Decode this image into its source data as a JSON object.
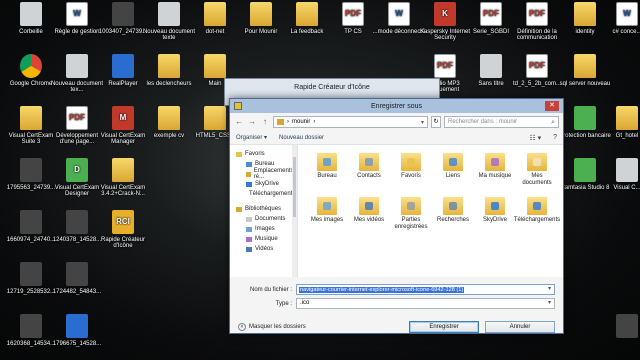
{
  "desktop": {
    "icons": [
      {
        "label": "Corbeille",
        "kind": "gray",
        "glyph": ""
      },
      {
        "label": "Règle de gestion",
        "kind": "word",
        "glyph": "W"
      },
      {
        "label": "1003407_24739...",
        "kind": "dark",
        "glyph": ""
      },
      {
        "label": "Nouveau document texte",
        "kind": "gray",
        "glyph": ""
      },
      {
        "label": "dot-net",
        "kind": "folder",
        "glyph": ""
      },
      {
        "label": "Pour Mounir",
        "kind": "folder",
        "glyph": ""
      },
      {
        "label": "La feedback",
        "kind": "folder",
        "glyph": ""
      },
      {
        "label": "TP CS",
        "kind": "pdf",
        "glyph": "PDF"
      },
      {
        "label": "...mode déconnecté",
        "kind": "word",
        "glyph": "W"
      },
      {
        "label": "Kaspersky Internet Security",
        "kind": "red",
        "glyph": "K"
      },
      {
        "label": "Serie_SGBDI",
        "kind": "pdf",
        "glyph": "PDF"
      },
      {
        "label": "Définition de la communication",
        "kind": "pdf",
        "glyph": "PDF"
      },
      {
        "label": "identity",
        "kind": "folder",
        "glyph": ""
      },
      {
        "label": "c# conce...",
        "kind": "word",
        "glyph": "W"
      },
      {
        "label": "Google Chrome",
        "kind": "chrome",
        "glyph": ""
      },
      {
        "label": "Nouveau document tex...",
        "kind": "gray",
        "glyph": ""
      },
      {
        "label": "RealPlayer",
        "kind": "blue",
        "glyph": ""
      },
      {
        "label": "les declencheurs",
        "kind": "folder",
        "glyph": ""
      },
      {
        "label": "Main",
        "kind": "folder",
        "glyph": ""
      },
      {
        "label": "Audio MP3 ...quement",
        "kind": "pdf",
        "glyph": "PDF"
      },
      {
        "label": "Sans titre",
        "kind": "gray",
        "glyph": ""
      },
      {
        "label": "td_2_5_2b_com...",
        "kind": "pdf",
        "glyph": "PDF"
      },
      {
        "label": "sql server nouveau",
        "kind": "folder",
        "glyph": ""
      },
      {
        "label": "Visual CertExam Suite 3",
        "kind": "folder",
        "glyph": ""
      },
      {
        "label": "Développement d'une page...",
        "kind": "pdf",
        "glyph": "PDF"
      },
      {
        "label": "Visual CertExam Manager",
        "kind": "red",
        "glyph": "M"
      },
      {
        "label": "exemple cv",
        "kind": "folder",
        "glyph": ""
      },
      {
        "label": "HTML5_CSS3",
        "kind": "folder",
        "glyph": ""
      },
      {
        "label": "Protection bancaire",
        "kind": "green",
        "glyph": ""
      },
      {
        "label": "Gt_hotel",
        "kind": "folder",
        "glyph": ""
      },
      {
        "label": "1795563_24739...",
        "kind": "dark",
        "glyph": ""
      },
      {
        "label": "Visual CertExam Designer",
        "kind": "green",
        "glyph": "D"
      },
      {
        "label": "Visual CertExam 3.4.2+Crack-N...",
        "kind": "folder",
        "glyph": ""
      },
      {
        "label": "Camtasia Studio 8",
        "kind": "green",
        "glyph": ""
      },
      {
        "label": "Visual C...",
        "kind": "gray",
        "glyph": ""
      },
      {
        "label": "1660974_24740...",
        "kind": "dark",
        "glyph": ""
      },
      {
        "label": "1240378_14528...",
        "kind": "dark",
        "glyph": ""
      },
      {
        "label": "Rapide Créateur d'Icône",
        "kind": "yellow",
        "glyph": "RCI"
      },
      {
        "label": "12719_2528532...",
        "kind": "dark",
        "glyph": ""
      },
      {
        "label": "1724482_54843...",
        "kind": "dark",
        "glyph": ""
      },
      {
        "label": "1620368_14534...",
        "kind": "dark",
        "glyph": ""
      },
      {
        "label": "1796675_14528...",
        "kind": "blue",
        "glyph": ""
      },
      {
        "label": "",
        "kind": "dark",
        "glyph": ""
      }
    ]
  },
  "bg_window": {
    "title": "Rapide Créateur d'Icône"
  },
  "dialog": {
    "title": "Enregistrer sous",
    "close_glyph": "✕",
    "back_glyph": "←",
    "forward_glyph": "→",
    "up_glyph": "↑",
    "path_sep": "›",
    "path_current": "mounir",
    "path_dd": "▾",
    "refresh_glyph": "↻",
    "search_placeholder": "Rechercher dans : mounir",
    "search_glyph": "⌕",
    "toolbar": {
      "organize": "Organiser ▾",
      "new_folder": "Nouveau dossier",
      "view_glyph": "☷ ▾",
      "help_glyph": "?"
    },
    "nav": {
      "favorites": "Favoris",
      "fav_items": [
        "Bureau",
        "Emplacements ré...",
        "SkyDrive",
        "Téléchargements"
      ],
      "libraries": "Bibliothèques",
      "lib_items": [
        "Documents",
        "Images",
        "Musique",
        "Vidéos"
      ]
    },
    "files": [
      {
        "name": "Bureau",
        "color": "#5a9bd5"
      },
      {
        "name": "Contacts",
        "color": "#7a9ab5"
      },
      {
        "name": "Favoris",
        "color": "#e6c34a"
      },
      {
        "name": "Liens",
        "color": "#4a8ad0"
      },
      {
        "name": "Ma musique",
        "color": "#a66fc9"
      },
      {
        "name": "Mes documents",
        "color": "#f0e4c0"
      },
      {
        "name": "Mes images",
        "color": "#6fa3cf"
      },
      {
        "name": "Mes vidéos",
        "color": "#4a79b6"
      },
      {
        "name": "Parties enregistrées",
        "color": "#9a9aa2"
      },
      {
        "name": "Recherches",
        "color": "#6b87a8"
      },
      {
        "name": "SkyDrive",
        "color": "#2e7bd6"
      },
      {
        "name": "Téléchargements",
        "color": "#3a7fd0"
      }
    ],
    "filename_label": "Nom du fichier :",
    "filename_value": "navigateur-courrier-internet-explorer-microsoft-icone-6942-128 (1)",
    "type_label": "Type :",
    "type_value": ".ico",
    "dd_glyph": "▾",
    "hide_folders": "Masquer les dossiers",
    "hide_glyph": "˄",
    "save": "Enregistrer",
    "cancel": "Annuler"
  }
}
